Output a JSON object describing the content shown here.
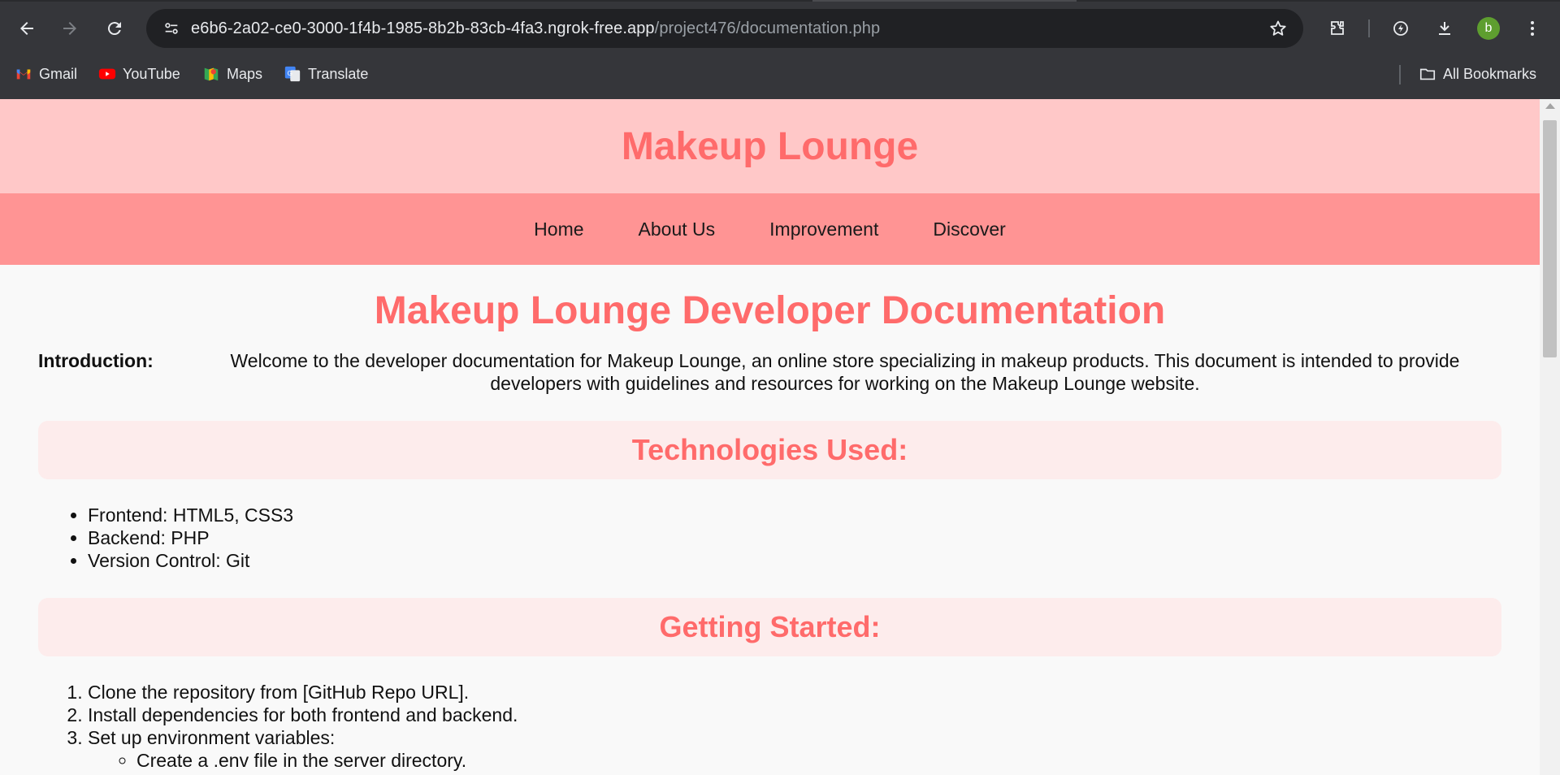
{
  "browser": {
    "url_host": "e6b6-2a02-ce0-3000-1f4b-1985-8b2b-83cb-4fa3.ngrok-free.app",
    "url_path": "/project476/documentation.php",
    "profile_initial": "b",
    "bookmarks": [
      {
        "label": "Gmail",
        "icon": "gmail-icon"
      },
      {
        "label": "YouTube",
        "icon": "youtube-icon"
      },
      {
        "label": "Maps",
        "icon": "maps-icon"
      },
      {
        "label": "Translate",
        "icon": "translate-icon"
      }
    ],
    "all_bookmarks_label": "All Bookmarks"
  },
  "site": {
    "title": "Makeup Lounge",
    "nav": [
      "Home",
      "About Us",
      "Improvement",
      "Discover"
    ]
  },
  "doc": {
    "title": "Makeup Lounge Developer Documentation",
    "intro_label": "Introduction:",
    "intro_text": "Welcome to the developer documentation for Makeup Lounge, an online store specializing in makeup products. This document is intended to provide developers with guidelines and resources for working on the Makeup Lounge website.",
    "technologies_heading": "Technologies Used:",
    "technologies": [
      "Frontend: HTML5, CSS3",
      "Backend: PHP",
      "Version Control: Git"
    ],
    "getting_started_heading": "Getting Started:",
    "getting_started": [
      "Clone the repository from [GitHub Repo URL].",
      "Install dependencies for both frontend and backend.",
      "Set up environment variables:"
    ],
    "env_subitems": [
      "Create a .env file in the server directory."
    ]
  },
  "colors": {
    "header_bg": "#ffc8c8",
    "nav_bg": "#ff9494",
    "accent": "#ff6b6b",
    "section_bg": "#fdecec"
  }
}
